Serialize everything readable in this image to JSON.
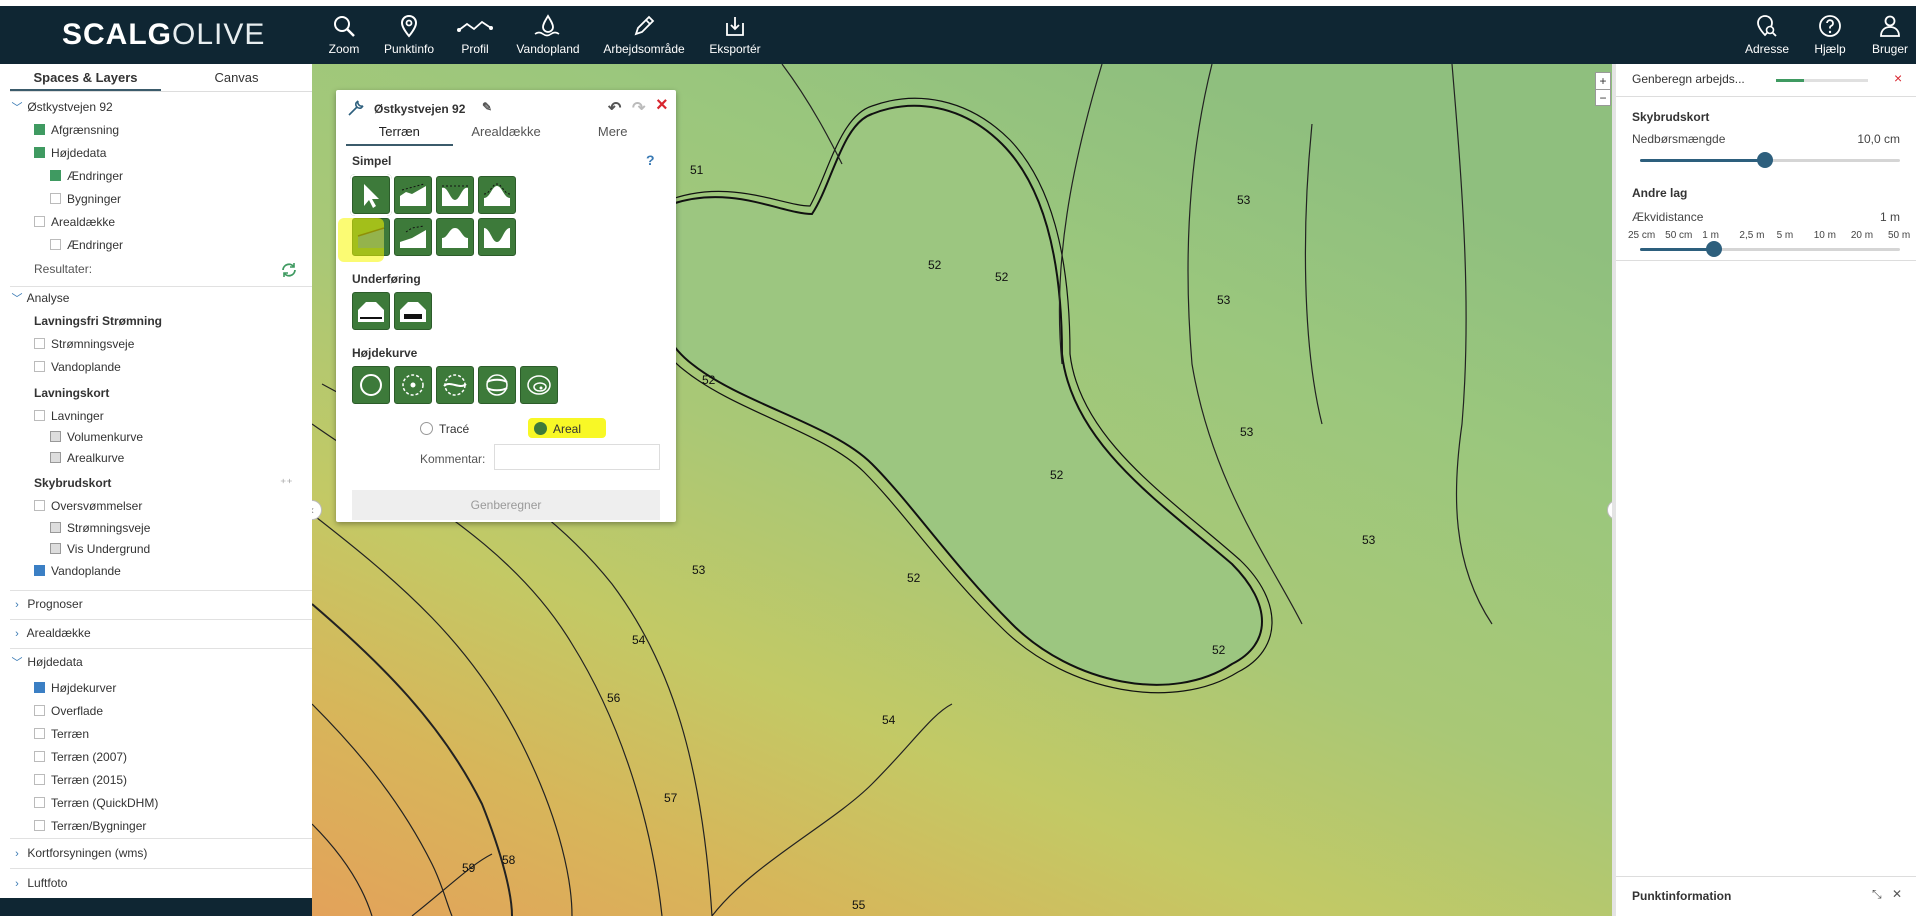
{
  "app": {
    "logo_part1": "SCALG",
    "logo_part2": "OLIVE"
  },
  "toolbar": [
    {
      "label": "Zoom",
      "icon": "search-icon"
    },
    {
      "label": "Punktinfo",
      "icon": "map-pin-icon"
    },
    {
      "label": "Profil",
      "icon": "profile-line-icon"
    },
    {
      "label": "Vandopland",
      "icon": "water-icon"
    },
    {
      "label": "Arbejdsområde",
      "icon": "pencil-icon"
    },
    {
      "label": "Eksportér",
      "icon": "export-icon"
    }
  ],
  "right_tools": [
    {
      "label": "Adresse",
      "icon": "address-search-icon"
    },
    {
      "label": "Hjælp",
      "icon": "help-icon"
    },
    {
      "label": "Bruger",
      "icon": "user-icon"
    }
  ],
  "left_panel": {
    "tabs": [
      "Spaces & Layers",
      "Canvas"
    ],
    "space_name": "Østkystvejen 92",
    "space_items": [
      "Afgrænsning",
      "Højdedata",
      "Ændringer",
      "Bygninger",
      "Arealdække",
      "Ændringer"
    ],
    "results_label": "Resultater:",
    "analyse": {
      "title": "Analyse",
      "g1_title": "Lavningsfri Strømning",
      "g1_items": [
        "Strømningsveje",
        "Vandoplande"
      ],
      "g2_title": "Lavningskort",
      "g2_items": [
        "Lavninger",
        "Volumenkurve",
        "Arealkurve"
      ],
      "g3_title": "Skybrudskort",
      "g3_items": [
        "Oversvømmelser",
        "Strømningsveje",
        "Vis Undergrund",
        "Vandoplande"
      ]
    },
    "prognoser": "Prognoser",
    "arealdaekke": "Arealdække",
    "hojdedata": {
      "title": "Højdedata",
      "items": [
        "Højdekurver",
        "Overflade",
        "Terræn",
        "Terræn (2007)",
        "Terræn (2015)",
        "Terræn (QuickDHM)",
        "Terræn/Bygninger"
      ]
    },
    "kortforsyningen": "Kortforsyningen (wms)",
    "luftfoto": "Luftfoto"
  },
  "dialog": {
    "title": "Østkystvejen 92",
    "tabs": [
      "Terræn",
      "Arealdække",
      "Mere"
    ],
    "help": "?",
    "close": "×",
    "section_simpel": "Simpel",
    "section_underforing": "Underføring",
    "section_hojdekurve": "Højdekurve",
    "radio_trace": "Tracé",
    "radio_areal": "Areal",
    "comment_label": "Kommentar:",
    "comment_value": "",
    "recalc_button": "Genberegner"
  },
  "map": {
    "contours": [
      "51",
      "52",
      "52",
      "52",
      "52",
      "52",
      "52",
      "53",
      "53",
      "53",
      "53",
      "53",
      "54",
      "54",
      "55",
      "56",
      "57",
      "58",
      "59"
    ],
    "zoom_in": "+",
    "zoom_out": "−"
  },
  "right_panel": {
    "progress_label": "Genberegn arbejds...",
    "progress_value": 0.3,
    "section1_title": "Skybrudskort",
    "rain_label": "Nedbørsmængde",
    "rain_value": "10,0 cm",
    "rain_fraction": 0.48,
    "section2_title": "Andre lag",
    "contour_label": "Ækvidistance",
    "contour_value": "1 m",
    "contour_ticks": [
      "25 cm",
      "50 cm",
      "1 m",
      "2,5 m",
      "5 m",
      "10 m",
      "20 m",
      "50 m"
    ],
    "contour_index": 2,
    "bottom_title": "Punktinformation"
  },
  "colors": {
    "topbar": "#0f2633",
    "accent_green": "#3f9a61",
    "tool_green": "#3d7a3a",
    "highlight": "#f7f700",
    "slider": "#2d5f7d"
  }
}
